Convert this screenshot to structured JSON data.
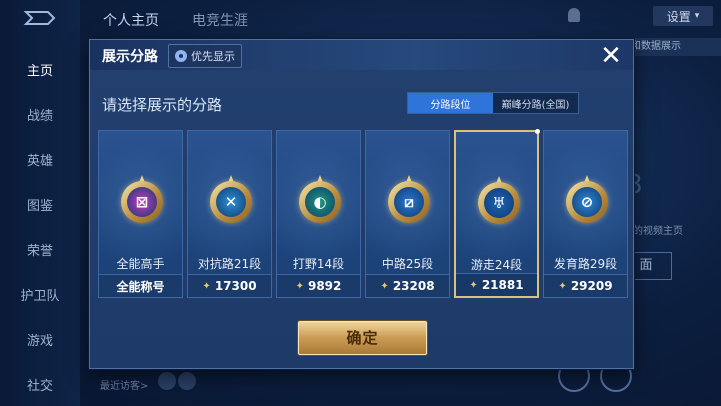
{
  "app": {
    "sidebar": {
      "items": [
        {
          "label": "主页",
          "active": true
        },
        {
          "label": "战绩"
        },
        {
          "label": "英雄"
        },
        {
          "label": "图鉴"
        },
        {
          "label": "荣誉"
        },
        {
          "label": "护卫队"
        },
        {
          "label": "游戏"
        },
        {
          "label": "社交"
        }
      ]
    },
    "topnav": {
      "items": [
        {
          "label": "个人主页"
        },
        {
          "label": "电竞生涯"
        }
      ],
      "settings_label": "设置"
    },
    "background": {
      "data_btn_label": "和数据展示",
      "video_text": "的视频主页",
      "right_btn_label": "面",
      "recent_label": "最近访客>"
    }
  },
  "dialog": {
    "title": "展示分路",
    "priority_label": "优先显示",
    "close_symbol": "✕",
    "prompt": "请选择展示的分路",
    "segments": [
      {
        "label": "分路段位",
        "active": true
      },
      {
        "label": "巅峰分路(全国)",
        "active": false
      }
    ],
    "cards": [
      {
        "label": "全能高手",
        "value": "全能称号",
        "show_star": false,
        "color": "#c83cc0",
        "glyph": "⊠",
        "selected": false
      },
      {
        "label": "对抗路21段",
        "value": "17300",
        "show_star": true,
        "color": "#2f8fd6",
        "glyph": "✕",
        "selected": false
      },
      {
        "label": "打野14段",
        "value": "9892",
        "show_star": true,
        "color": "#1f9a7a",
        "glyph": "◐",
        "selected": false
      },
      {
        "label": "中路25段",
        "value": "23208",
        "show_star": true,
        "color": "#2a78d0",
        "glyph": "⧄",
        "selected": false
      },
      {
        "label": "游走24段",
        "value": "21881",
        "show_star": true,
        "color": "#1d63b8",
        "glyph": "♅",
        "selected": true
      },
      {
        "label": "发育路29段",
        "value": "29209",
        "show_star": true,
        "color": "#2f86d8",
        "glyph": "⊘",
        "selected": false
      }
    ],
    "confirm_label": "确定"
  }
}
